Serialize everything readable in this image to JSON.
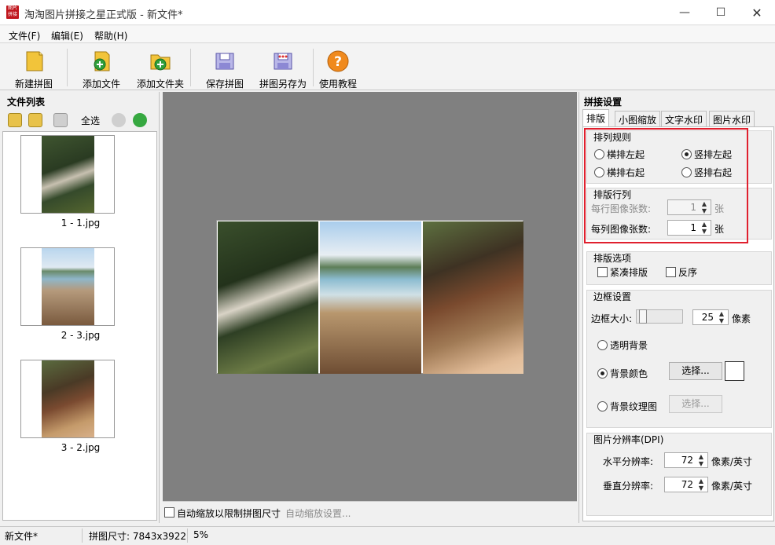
{
  "window": {
    "title": "淘淘图片拼接之星正式版 - 新文件*",
    "logo_text": "图片拼接",
    "minimize_icon": "minimize-icon",
    "maximize_icon": "maximize-icon",
    "close_icon": "close-icon"
  },
  "menu": [
    "文件(F)",
    "编辑(E)",
    "帮助(H)"
  ],
  "toolbar": [
    {
      "label": "新建拼图",
      "icon": "new-collage-icon"
    },
    {
      "label": "添加文件",
      "icon": "add-file-icon"
    },
    {
      "label": "添加文件夹",
      "icon": "add-folder-icon"
    },
    {
      "label": "保存拼图",
      "icon": "save-collage-icon"
    },
    {
      "label": "拼图另存为",
      "icon": "save-as-icon"
    },
    {
      "label": "使用教程",
      "icon": "help-icon"
    }
  ],
  "file_list": {
    "title": "文件列表",
    "select_all": "全选",
    "files": [
      "1 - 1.jpg",
      "2 - 3.jpg",
      "3 - 2.jpg"
    ]
  },
  "canvas": {
    "auto_zoom_label": "自动缩放以限制拼图尺寸",
    "auto_zoom_settings": "自动缩放设置..."
  },
  "settings": {
    "title": "拼接设置",
    "tabs": [
      "排版",
      "小图缩放",
      "文字水印",
      "图片水印"
    ],
    "arrangement": {
      "title": "排列规则",
      "options": [
        "横排左起",
        "竖排左起",
        "横排右起",
        "竖排右起"
      ],
      "selected": "竖排左起"
    },
    "rows_cols": {
      "title": "排版行列",
      "per_row_label": "每行图像张数:",
      "per_row_value": "1",
      "per_col_label": "每列图像张数:",
      "per_col_value": "1",
      "unit": "张"
    },
    "layout_options": {
      "title": "排版选项",
      "compact": "紧凑排版",
      "reverse": "反序"
    },
    "border": {
      "title": "边框设置",
      "size_label": "边框大小:",
      "size_value": "25",
      "unit": "像素",
      "transparent_bg": "透明背景",
      "bg_color": "背景颜色",
      "bg_texture": "背景纹理图",
      "choose": "选择...",
      "bg_color_value": "#ffffff"
    },
    "dpi": {
      "title": "图片分辨率(DPI)",
      "h_label": "水平分辨率:",
      "h_value": "72",
      "v_label": "垂直分辨率:",
      "v_value": "72",
      "unit": "像素/英寸"
    }
  },
  "status": {
    "file": "新文件*",
    "size": "拼图尺寸: 7843x3922",
    "zoom": "5%"
  }
}
